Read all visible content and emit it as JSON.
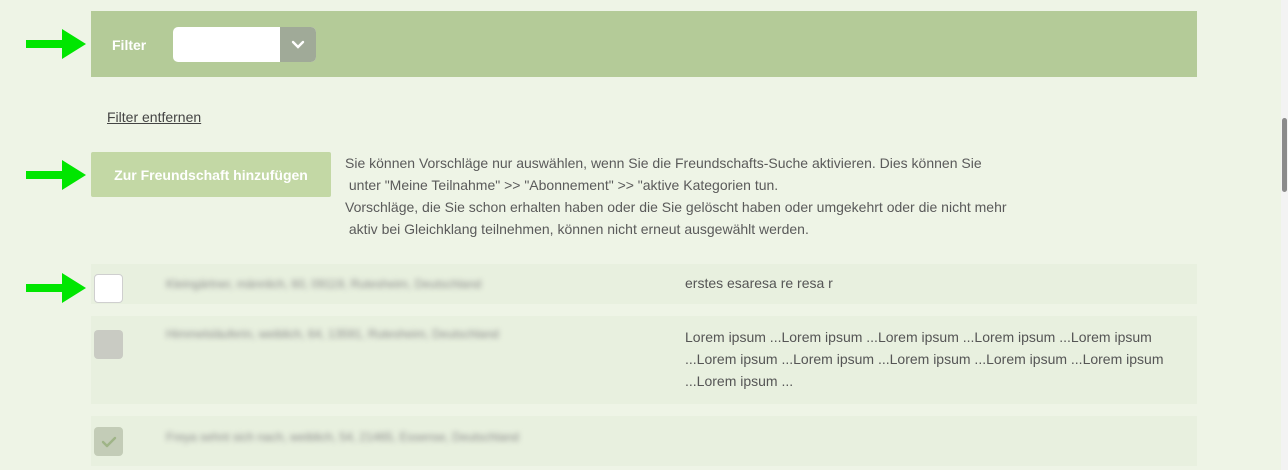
{
  "colors": {
    "page_background": "#eef4e6",
    "filter_bar": "#b4cb98",
    "button": "#c3d8a5",
    "row_background": "#e8f0df",
    "arrow": "#00e600"
  },
  "filter": {
    "label": "Filter",
    "selected_value": ""
  },
  "remove_filter_label": "Filter entfernen",
  "add_button_label": "Zur Freundschaft hinzufügen",
  "info_text": "Sie können Vorschläge nur auswählen, wenn Sie die Freundschafts-Suche aktivieren. Dies können Sie\n unter \"Meine Teilnahme\" >> \"Abonnement\" >> \"aktive Kategorien tun.\nVorschläge, die Sie schon erhalten haben oder die Sie gelöscht haben oder umgekehrt oder die nicht mehr\n aktiv bei Gleichklang teilnehmen, können nicht erneut ausgewählt werden.",
  "suggestions": [
    {
      "profile": "Kleingärtner, männlich, 60, 09119, Rutesheim, Deutschland",
      "comment": "erstes esaresa re resa r",
      "state": "selectable"
    },
    {
      "profile": "Himmelsläuferin, weiblich, 64, 13591, Rutesheim, Deutschland",
      "comment": "Lorem ipsum ...Lorem ipsum ...Lorem ipsum ...Lorem ipsum ...Lorem ipsum ...Lorem ipsum ...Lorem ipsum ...Lorem ipsum ...Lorem ipsum ...Lorem ipsum ...Lorem ipsum ...",
      "state": "disabled"
    },
    {
      "profile": "Freya sehnt sich nach, weiblich, 54, 21465, Essense, Deutschland",
      "comment": "",
      "state": "checked"
    }
  ],
  "icons": {
    "arrow": "right-arrow-icon",
    "dropdown": "chevron-down-icon",
    "check": "checkmark-icon"
  }
}
